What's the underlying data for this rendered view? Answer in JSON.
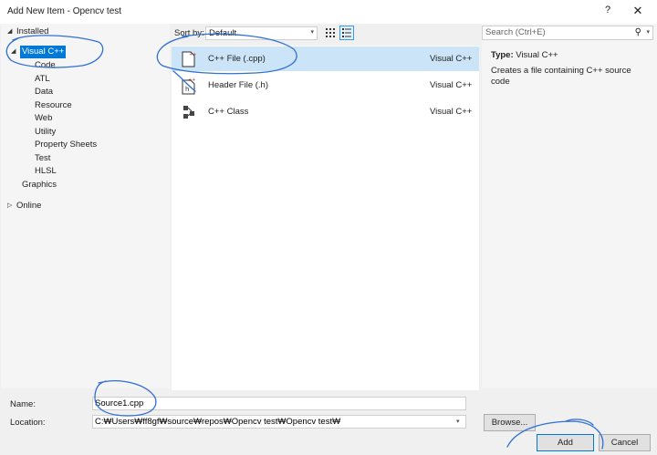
{
  "window": {
    "title": "Add New Item - Opencv test",
    "help_glyph": "?",
    "close_glyph": "✕"
  },
  "tree": {
    "installed": "Installed",
    "visual_cpp": "Visual C++",
    "children": [
      "Code",
      "ATL",
      "Data",
      "Resource",
      "Web",
      "Utility",
      "Property Sheets",
      "Test",
      "HLSL"
    ],
    "graphics": "Graphics",
    "online": "Online"
  },
  "sort": {
    "label": "Sort by:",
    "value": "Default"
  },
  "templates": [
    {
      "name": "C++ File (.cpp)",
      "type": "Visual C++",
      "icon": "cpp-file-icon"
    },
    {
      "name": "Header File (.h)",
      "type": "Visual C++",
      "icon": "header-file-icon"
    },
    {
      "name": "C++ Class",
      "type": "Visual C++",
      "icon": "cpp-class-icon"
    }
  ],
  "search": {
    "placeholder": "Search (Ctrl+E)",
    "icon_glyph": "⚲"
  },
  "details": {
    "type_label": "Type:",
    "type_value": "Visual C++",
    "description": "Creates a file containing C++ source code"
  },
  "form": {
    "name_label": "Name:",
    "name_value": "Source1.cpp",
    "location_label": "Location:",
    "location_value": "C:₩Users₩ff8gf₩source₩repos₩Opencv test₩Opencv test₩",
    "browse_label": "Browse...",
    "add_label": "Add",
    "cancel_label": "Cancel"
  },
  "colors": {
    "accent": "#0078d7",
    "selection": "#cce4f7",
    "annotation_ink": "#2f6fd6"
  }
}
